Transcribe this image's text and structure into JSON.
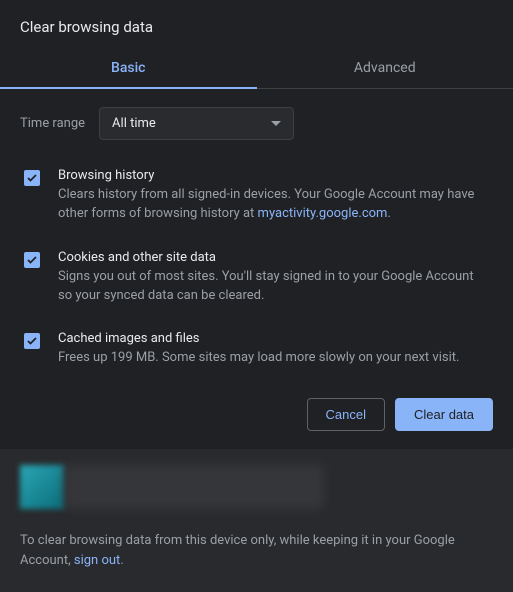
{
  "title": "Clear browsing data",
  "tabs": {
    "basic": "Basic",
    "advanced": "Advanced"
  },
  "time": {
    "label": "Time range",
    "value": "All time"
  },
  "opts": {
    "history": {
      "title": "Browsing history",
      "desc_a": "Clears history from all signed-in devices. Your Google Account may have other forms of browsing history at ",
      "link": "myactivity.google.com",
      "desc_b": "."
    },
    "cookies": {
      "title": "Cookies and other site data",
      "desc": "Signs you out of most sites. You'll stay signed in to your Google Account so your synced data can be cleared."
    },
    "cache": {
      "title": "Cached images and files",
      "desc": "Frees up 199 MB. Some sites may load more slowly on your next visit."
    }
  },
  "buttons": {
    "cancel": "Cancel",
    "clear": "Clear data"
  },
  "footer": {
    "text_a": "To clear browsing data from this device only, while keeping it in your Google Account, ",
    "link": "sign out",
    "text_b": "."
  }
}
